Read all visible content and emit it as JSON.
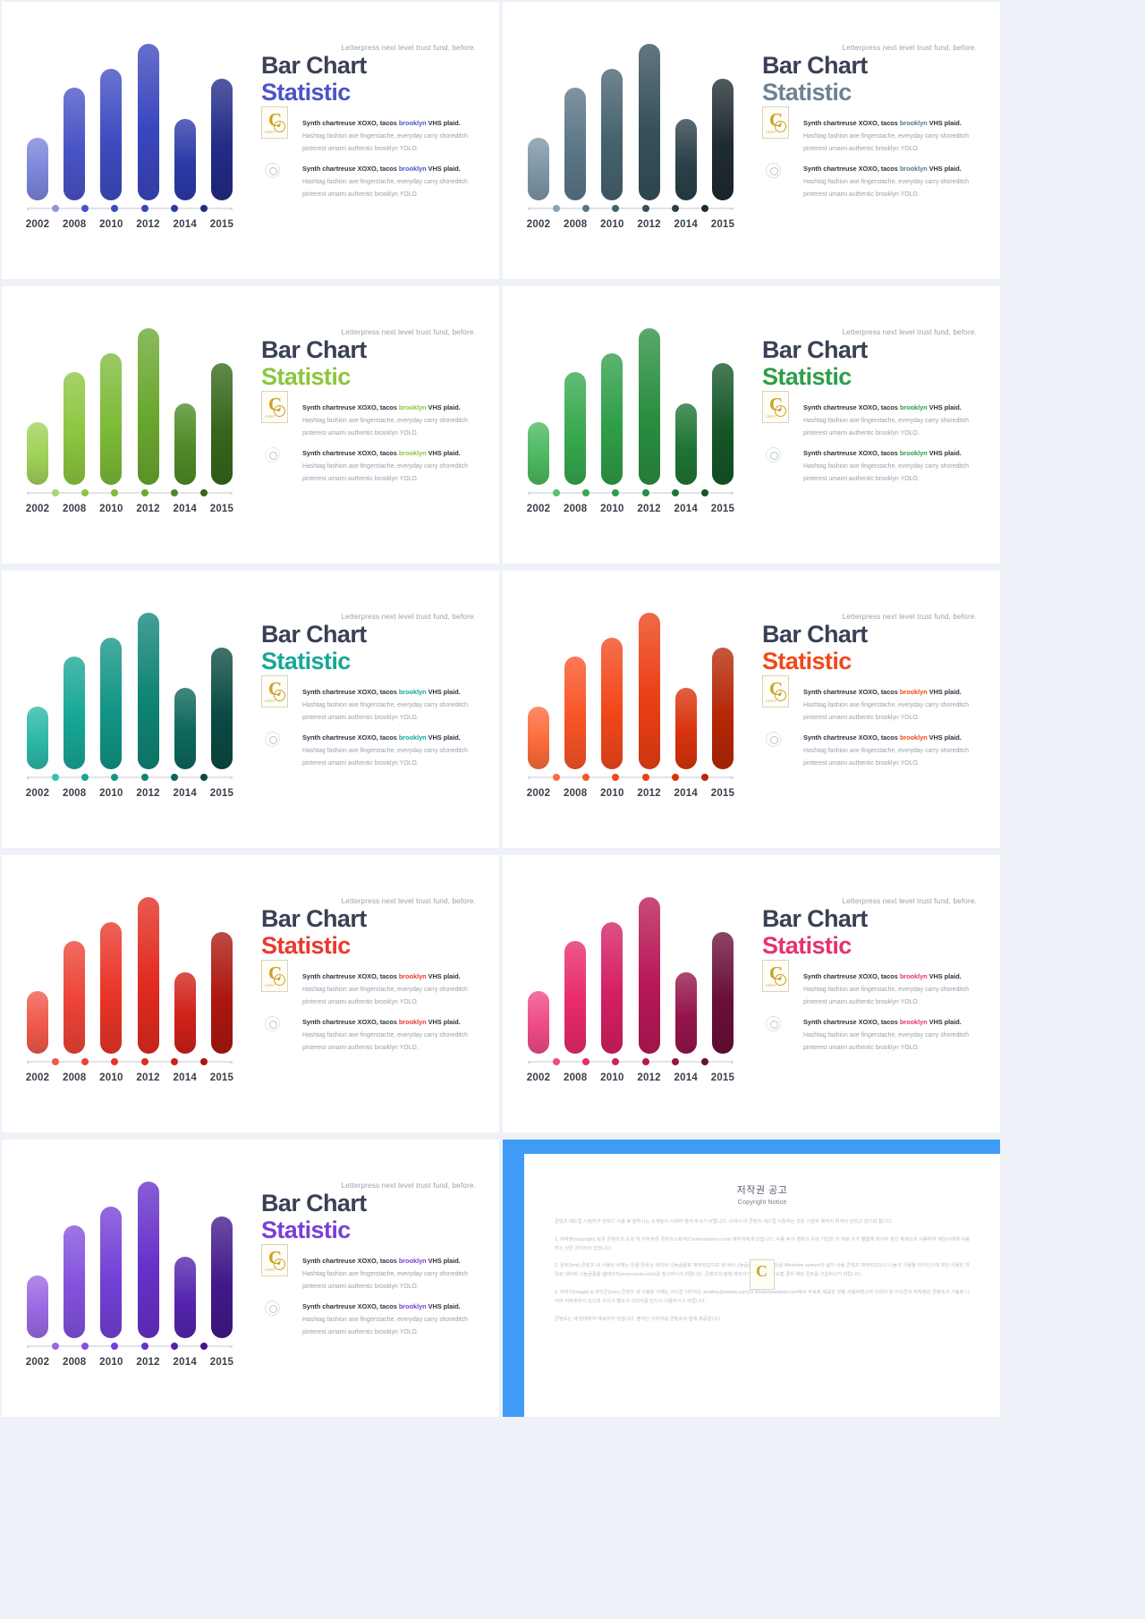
{
  "deck": {
    "slide_count": 9,
    "common": {
      "eyebrow": "Letterpress next level trust fund, before.",
      "title_line1": "Bar Chart",
      "title_line2": "Statistic",
      "block1_lead_a": "Synth chartreuse XOXO, tacos ",
      "block1_lead_b": "brooklyn",
      "block1_lead_c": " VHS plaid.",
      "block_body_line1": "Hashtag fashion axe fingerstache, everyday carry shoreditch",
      "block_body_line2": "pinterest umami authentic brooklyn YOLO.",
      "badge_letter": "C",
      "badge_tag": "CERT"
    }
  },
  "chart_data": {
    "type": "bar",
    "title": "Bar Chart Statistic",
    "xlabel": "",
    "ylabel": "",
    "categories": [
      "2002",
      "2008",
      "2010",
      "2012",
      "2014",
      "2015"
    ],
    "values": [
      40,
      72,
      84,
      100,
      52,
      78
    ],
    "ylim": [
      0,
      100
    ],
    "grid": false,
    "legend": "none",
    "note": "Identical six-bar series repeated across nine color variants; bar heights expressed as percent of plot height."
  },
  "slides": [
    {
      "id": "slide-indigo",
      "theme": "indigo",
      "title_accent": "#4a55c7",
      "eyebrow_accent": "#9aa1ad",
      "bar_colors": [
        "#7b85d8",
        "#4854c4",
        "#3f4bc0",
        "#3a46be",
        "#2c3aa8",
        "#232b86"
      ],
      "dot_colors": [
        "#8b95e0",
        "#4854c4",
        "#3f4bc0",
        "#3a46be",
        "#2c3aa8",
        "#232b86"
      ],
      "lead_accent": "#4a55c7",
      "ring_color": "#b9bfe8"
    },
    {
      "id": "slide-slate",
      "theme": "slate",
      "title_accent": "#6d8293",
      "eyebrow_accent": "#9aa1ad",
      "bar_colors": [
        "#7d95a5",
        "#5b7687",
        "#46626f",
        "#36505c",
        "#2b4048",
        "#1e2b31"
      ],
      "dot_colors": [
        "#8da4b3",
        "#5b7687",
        "#46626f",
        "#36505c",
        "#2b4048",
        "#1e2b31"
      ],
      "lead_accent": "#5b7687",
      "ring_color": "#b6c3cb"
    },
    {
      "id": "slide-lime",
      "theme": "lime",
      "title_accent": "#8cc63f",
      "eyebrow_accent": "#9aa1ad",
      "bar_colors": [
        "#9fd158",
        "#8cc63f",
        "#7dbb38",
        "#6aa82f",
        "#4e8a26",
        "#36661b"
      ],
      "dot_colors": [
        "#a8d76a",
        "#8cc63f",
        "#7dbb38",
        "#6aa82f",
        "#4e8a26",
        "#36661b"
      ],
      "lead_accent": "#8cc63f",
      "ring_color": "#cde7a8"
    },
    {
      "id": "slide-green",
      "theme": "green",
      "title_accent": "#2f9e48",
      "eyebrow_accent": "#9aa1ad",
      "bar_colors": [
        "#4cb85f",
        "#37a94e",
        "#2f9e48",
        "#2a8f40",
        "#1f7533",
        "#155627"
      ],
      "dot_colors": [
        "#57c26a",
        "#37a94e",
        "#2f9e48",
        "#2a8f40",
        "#1f7533",
        "#155627"
      ],
      "lead_accent": "#2f9e48",
      "ring_color": "#a9dcb5"
    },
    {
      "id": "slide-teal",
      "theme": "teal",
      "title_accent": "#16a898",
      "eyebrow_accent": "#9aa1ad",
      "bar_colors": [
        "#2bb8a6",
        "#17a695",
        "#129585",
        "#0f8476",
        "#0c675c",
        "#0a4a43"
      ],
      "dot_colors": [
        "#32c2b0",
        "#17a695",
        "#129585",
        "#0f8476",
        "#0c675c",
        "#0a4a43"
      ],
      "lead_accent": "#16a898",
      "ring_color": "#9fdfd6"
    },
    {
      "id": "slide-orange",
      "theme": "orange",
      "title_accent": "#f2481b",
      "eyebrow_accent": "#9aa1ad",
      "bar_colors": [
        "#fc6b3a",
        "#f85426",
        "#f2481b",
        "#ec3f14",
        "#d8330c",
        "#b62806"
      ],
      "dot_colors": [
        "#fc6b3a",
        "#f85426",
        "#f2481b",
        "#ec3f14",
        "#d8330c",
        "#b62806"
      ],
      "lead_accent": "#f2481b",
      "ring_color": "#f9b8a4"
    },
    {
      "id": "slide-red",
      "theme": "red",
      "title_accent": "#ea3a2e",
      "eyebrow_accent": "#9aa1ad",
      "bar_colors": [
        "#f0584a",
        "#ec4336",
        "#e93528",
        "#e22b1f",
        "#cf2118",
        "#ac1710"
      ],
      "dot_colors": [
        "#f0584a",
        "#ec4336",
        "#e93528",
        "#e22b1f",
        "#cf2118",
        "#ac1710"
      ],
      "lead_accent": "#ea3a2e",
      "ring_color": "#f6b5ae"
    },
    {
      "id": "slide-pink",
      "theme": "pink",
      "title_accent": "#e6326f",
      "eyebrow_accent": "#9aa1ad",
      "bar_colors": [
        "#ee4a86",
        "#e82a6b",
        "#d41f62",
        "#b81856",
        "#95154a",
        "#6b0f38"
      ],
      "dot_colors": [
        "#ee4a86",
        "#e82a6b",
        "#d41f62",
        "#b81856",
        "#95154a",
        "#6b0f38"
      ],
      "lead_accent": "#e6326f",
      "ring_color": "#f4a9c4"
    },
    {
      "id": "slide-purple",
      "theme": "purple",
      "title_accent": "#7b3fd4",
      "eyebrow_accent": "#9aa1ad",
      "bar_colors": [
        "#9a68e2",
        "#8251dd",
        "#7340d6",
        "#6631c9",
        "#5524ae",
        "#41198a"
      ],
      "dot_colors": [
        "#9a68e2",
        "#8251dd",
        "#7340d6",
        "#6631c9",
        "#5524ae",
        "#41198a"
      ],
      "lead_accent": "#7b3fd4",
      "ring_color": "#c9b0ef"
    }
  ],
  "copyright": {
    "title_ko": "저작권 공고",
    "title_en": "Copyright Notice",
    "intro": "콘텐츠 애드립 시청자가 한마디 사용 후 원하시는 소개놀이 시비하 찾아 주시기 바랍니다. 구하시 이 콘텐츠 애드립 시청자는 것은 시청자 제작이 목적이 안되고 않으며 합니다.",
    "p1": "1. 저작권(copyright) 보존 콘텐츠의 소유 및 저작권은 콘텐츠스토어(Contentstoreo.co.kr) 제작자에게 있습니다. 사용 후의 경매의 귀속 기업한 외 제로 수가 별협에 회사이 생긴 복제소프 이용하여 재임시에게 이용하는 것은 금지되어 있습니다.",
    "p2": "2. 폰트(font) 콘텐츠 내 사용된 서체는 한글 폰트는 네이버 나눔글꼴로 제작되었으며 네이버 나눔글꼴은 사용 시 한글 Windows system의 설치 사용 콘텐츠 제작되었으나 나눔이 사용을 라이선스에 대한 사용은 자유로 네이버 나눔글꼴을 웹에이지(www.naver.com)를 참고하시기 바랍니다. 콘텐츠의 말에 제것서가 있으므로 필요할 경우 해당 폰트를 구입하시기 바랍니다.",
    "p3": "3. 이미지(image) & 아이콘(icon) 콘텐츠 내 사용된 서체는 아이콘 이미지는 pixabay(pixabay.com)와 Weblyouweboly.com에서 무료로 제공한 것을 사용하였으며 이미지 및 아이콘의 저작권은 콘텐츠의 기술된 나이며 저작권자가 있으며 귀사가 별도이 이미지를 반드시 이용하시기 바랍니다.",
    "p4": "콘텐츠는 재 판매하여 배포하지 않습니다. 출처인 이미지를 콘텐츠와 함께 제공합니다."
  }
}
